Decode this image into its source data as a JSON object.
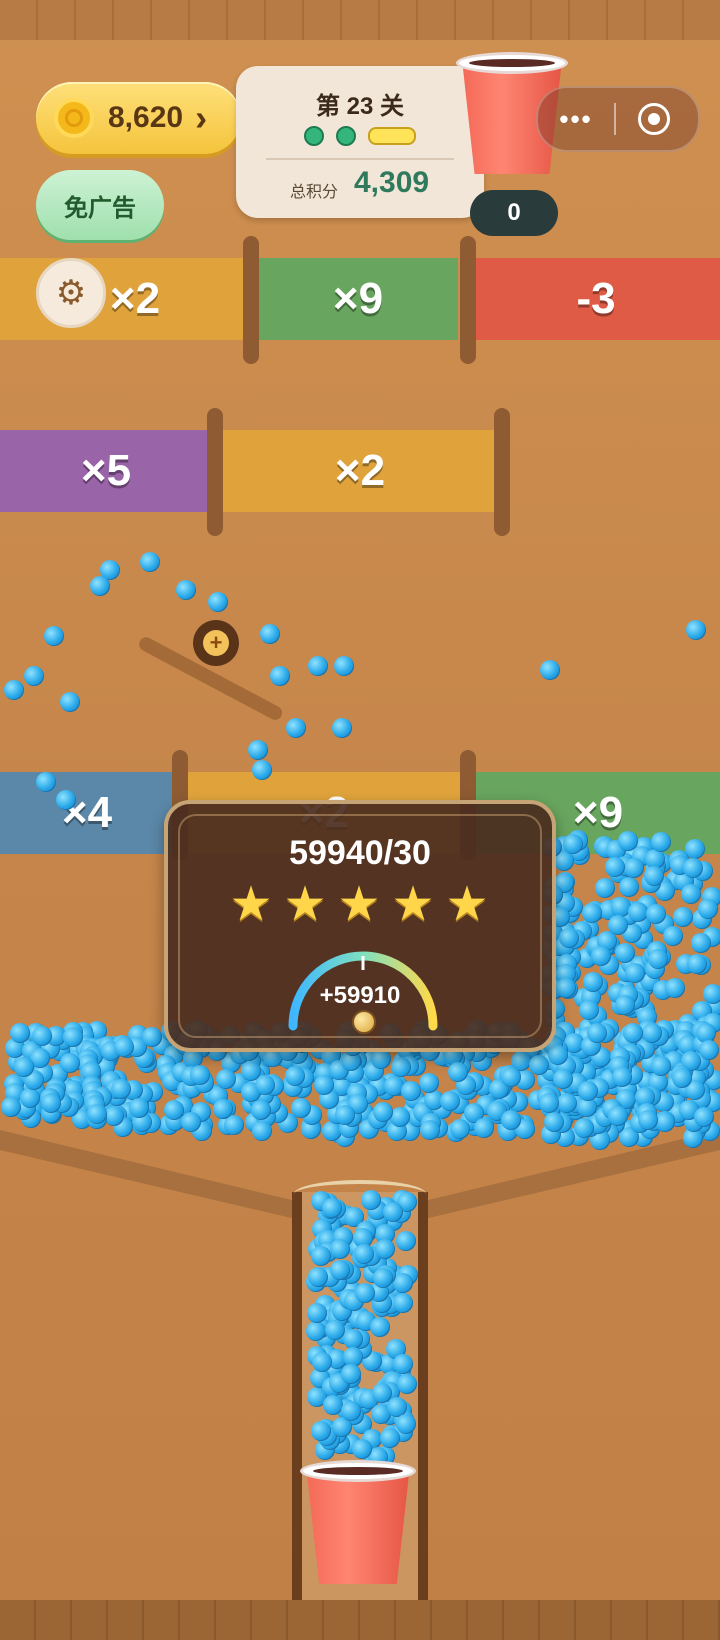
{
  "hud": {
    "coins": "8,620",
    "coins_chevron": "›",
    "ad_free_label": "免广告",
    "level_title": "第 23 关",
    "score_label": "总积分",
    "score_value": "4,309",
    "cup_counter": "0",
    "menu_dots": "•••",
    "level_progress": {
      "completed": 2,
      "current": 1
    }
  },
  "gates": {
    "row1": [
      "×2",
      "×9",
      "-3"
    ],
    "row2": [
      "×5",
      "×2"
    ],
    "row3": [
      "×4",
      "×2",
      "×9"
    ]
  },
  "result": {
    "score": "59940/30",
    "stars": 5,
    "gain": "+59910",
    "gauge_level": 0.85
  },
  "colors": {
    "gate_yellow": "#e0a33c",
    "gate_green": "#68a55e",
    "gate_red": "#df5b45",
    "gate_purple": "#9a64a8",
    "gate_blue": "#5b88a8",
    "ball": "#27a7e8"
  }
}
